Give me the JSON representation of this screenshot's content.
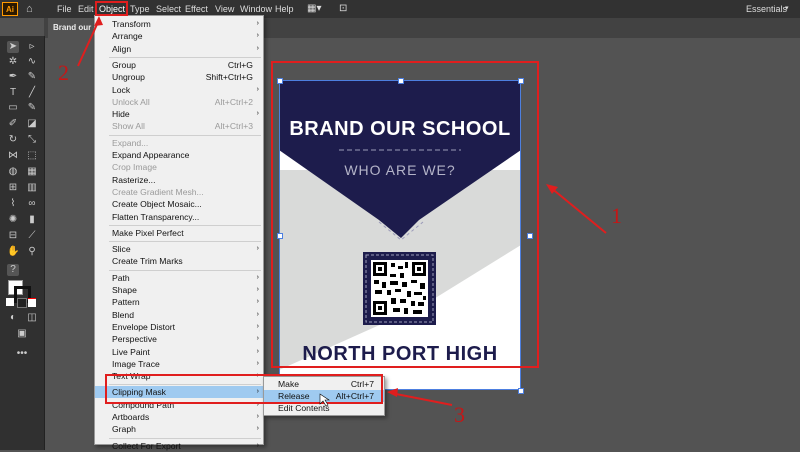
{
  "app": {
    "logo": "Ai",
    "home_icon": "home-icon",
    "workspace": "Essentials"
  },
  "menubar": [
    "File",
    "Edit",
    "Object",
    "Type",
    "Select",
    "Effect",
    "View",
    "Window",
    "Help"
  ],
  "document_tab": "Brand our School",
  "object_menu": [
    {
      "label": "Transform",
      "arrow": true
    },
    {
      "label": "Arrange",
      "arrow": true
    },
    {
      "label": "Align",
      "arrow": true
    },
    {
      "sep": true
    },
    {
      "label": "Group",
      "shortcut": "Ctrl+G"
    },
    {
      "label": "Ungroup",
      "shortcut": "Shift+Ctrl+G"
    },
    {
      "label": "Lock",
      "arrow": true
    },
    {
      "label": "Unlock All",
      "shortcut": "Alt+Ctrl+2",
      "disabled": true
    },
    {
      "label": "Hide",
      "arrow": true
    },
    {
      "label": "Show All",
      "shortcut": "Alt+Ctrl+3",
      "disabled": true
    },
    {
      "sep": true
    },
    {
      "label": "Expand...",
      "disabled": true
    },
    {
      "label": "Expand Appearance"
    },
    {
      "label": "Crop Image",
      "disabled": true
    },
    {
      "label": "Rasterize..."
    },
    {
      "label": "Create Gradient Mesh...",
      "disabled": true
    },
    {
      "label": "Create Object Mosaic..."
    },
    {
      "label": "Flatten Transparency..."
    },
    {
      "sep": true
    },
    {
      "label": "Make Pixel Perfect"
    },
    {
      "sep": true
    },
    {
      "label": "Slice",
      "arrow": true
    },
    {
      "label": "Create Trim Marks"
    },
    {
      "sep": true
    },
    {
      "label": "Path",
      "arrow": true
    },
    {
      "label": "Shape",
      "arrow": true
    },
    {
      "label": "Pattern",
      "arrow": true
    },
    {
      "label": "Blend",
      "arrow": true
    },
    {
      "label": "Envelope Distort",
      "arrow": true
    },
    {
      "label": "Perspective",
      "arrow": true
    },
    {
      "label": "Live Paint",
      "arrow": true
    },
    {
      "label": "Image Trace",
      "arrow": true
    },
    {
      "label": "Text Wrap",
      "arrow": true
    },
    {
      "sep": true
    },
    {
      "label": "Clipping Mask",
      "arrow": true,
      "highlight": true
    },
    {
      "label": "Compound Path",
      "arrow": true
    },
    {
      "label": "Artboards",
      "arrow": true
    },
    {
      "label": "Graph",
      "arrow": true
    },
    {
      "sep": true
    },
    {
      "label": "Collect For Export",
      "arrow": true
    }
  ],
  "submenu": [
    {
      "label": "Make",
      "shortcut": "Ctrl+7"
    },
    {
      "label": "Release",
      "shortcut": "Alt+Ctrl+7",
      "highlight": true
    },
    {
      "label": "Edit Contents"
    }
  ],
  "poster": {
    "title": "BRAND OUR SCHOOL",
    "subtitle": "WHO ARE WE?",
    "footer": "NORTH PORT HIGH"
  },
  "annotations": {
    "one": "1",
    "two": "2",
    "three": "3"
  },
  "colors": {
    "navy": "#1d1c4c",
    "annotation_red": "#e01e1e",
    "menu_highlight": "#9fcaf0"
  }
}
